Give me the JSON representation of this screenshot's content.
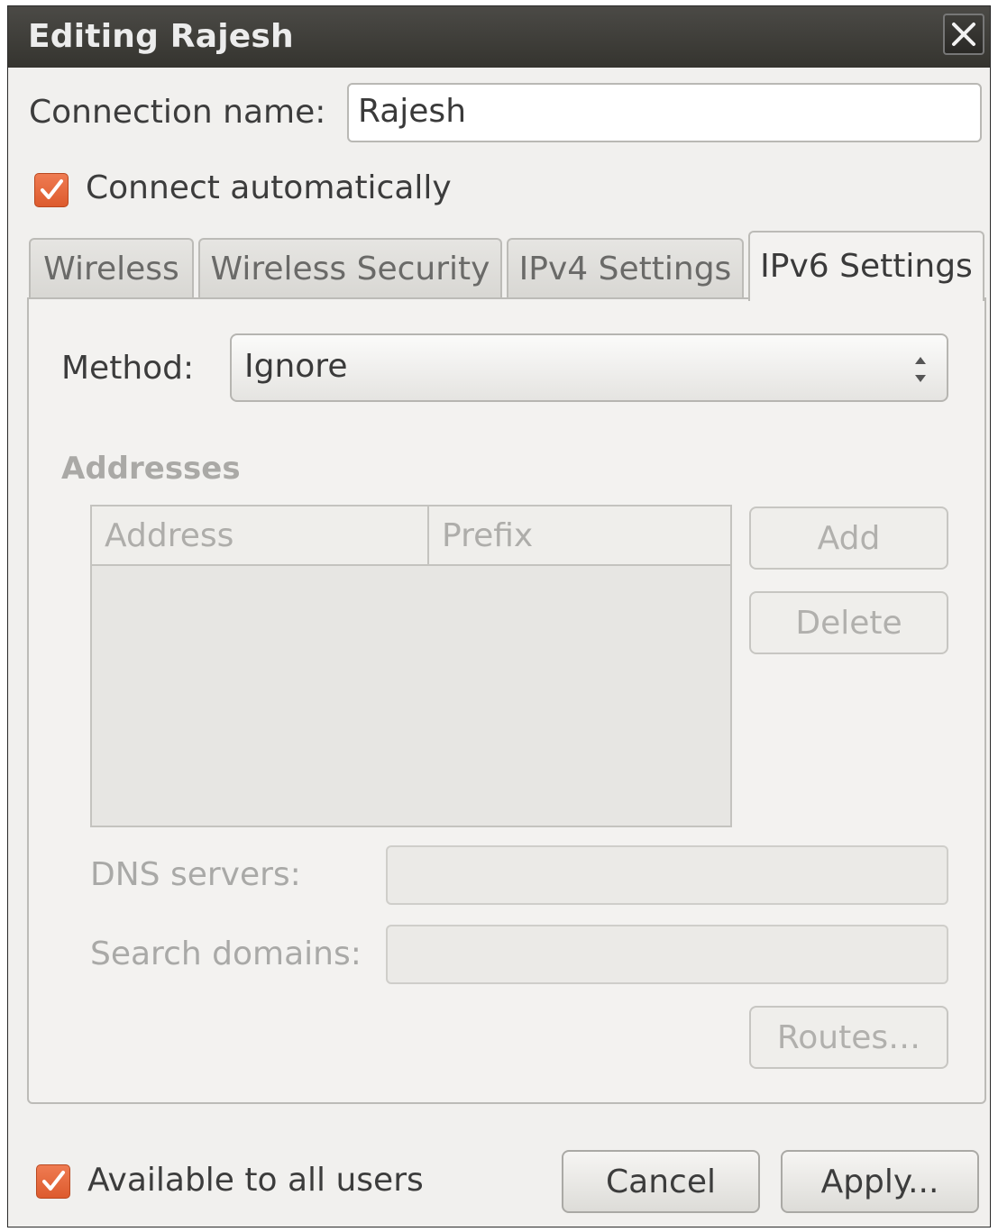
{
  "window": {
    "title": "Editing Rajesh"
  },
  "connection": {
    "name_label": "Connection name:",
    "name_value": "Rajesh",
    "auto_connect_label": "Connect automatically",
    "auto_connect_checked": true
  },
  "tabs": [
    {
      "label": "Wireless",
      "active": false
    },
    {
      "label": "Wireless Security",
      "active": false
    },
    {
      "label": "IPv4 Settings",
      "active": false
    },
    {
      "label": "IPv6 Settings",
      "active": true
    }
  ],
  "ipv6": {
    "method_label": "Method:",
    "method_value": "Ignore",
    "addresses_title": "Addresses",
    "columns": [
      "Address",
      "Prefix"
    ],
    "add_label": "Add",
    "delete_label": "Delete",
    "dns_label": "DNS servers:",
    "dns_value": "",
    "search_label": "Search domains:",
    "search_value": "",
    "routes_label": "Routes…"
  },
  "footer": {
    "all_users_label": "Available to all users",
    "all_users_checked": true,
    "cancel_label": "Cancel",
    "apply_label": "Apply..."
  },
  "colors": {
    "accent": "#dd5b2e",
    "titlebar": "#3c3b37"
  }
}
